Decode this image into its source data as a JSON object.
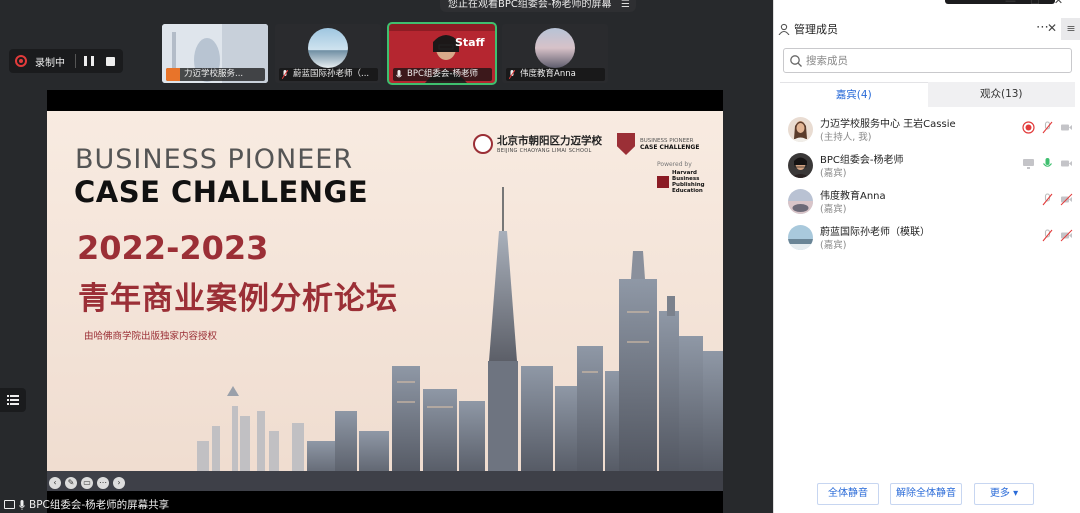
{
  "banner": {
    "text": "您正在观看BPC组委会-杨老师的屏幕"
  },
  "recording": {
    "label": "录制中"
  },
  "thumbnails": [
    {
      "label": "力迈学校服务..."
    },
    {
      "label": "蔚蓝国际孙老师（..."
    },
    {
      "label": "BPC组委会-杨老师",
      "overlay": "Staff"
    },
    {
      "label": "伟度教育Anna"
    }
  ],
  "slide": {
    "title_en_1": "BUSINESS PIONEER",
    "title_en_2": "CASE CHALLENGE",
    "year": "2022-2023",
    "title_cn": "青年商业案例分析论坛",
    "subtitle": "由哈佛商学院出版独家内容授权",
    "school_name": "北京市朝阳区力迈学校",
    "school_name_en": "BEIJING CHAOYANG LIMAI SCHOOL",
    "bpcc_1": "BUSINESS PIONEER",
    "bpcc_2": "CASE CHALLENGE",
    "powered_by": "Powered by",
    "hbp": "Harvard Business Publishing Education"
  },
  "share_footer": {
    "text": "BPC组委会-杨老师的屏幕共享"
  },
  "panel": {
    "title": "管理成员",
    "search_placeholder": "搜索成员",
    "tabs": [
      {
        "label": "嘉宾(4)"
      },
      {
        "label": "观众(13)"
      }
    ],
    "members": [
      {
        "name": "力迈学校服务中心 王岩Cassie",
        "role": "(主持人, 我)"
      },
      {
        "name": "BPC组委会-杨老师",
        "role": "(嘉宾)"
      },
      {
        "name": "伟度教育Anna",
        "role": "(嘉宾)"
      },
      {
        "name": "蔚蓝国际孙老师（模联）",
        "role": "(嘉宾)"
      }
    ],
    "actions": {
      "mute_all": "全体静音",
      "unmute_all": "解除全体静音",
      "more": "更多 ▾"
    }
  },
  "colors": {
    "accent": "#2a6bd8",
    "brand_red": "#9b2f36",
    "mic_green": "#3fbf6f"
  }
}
